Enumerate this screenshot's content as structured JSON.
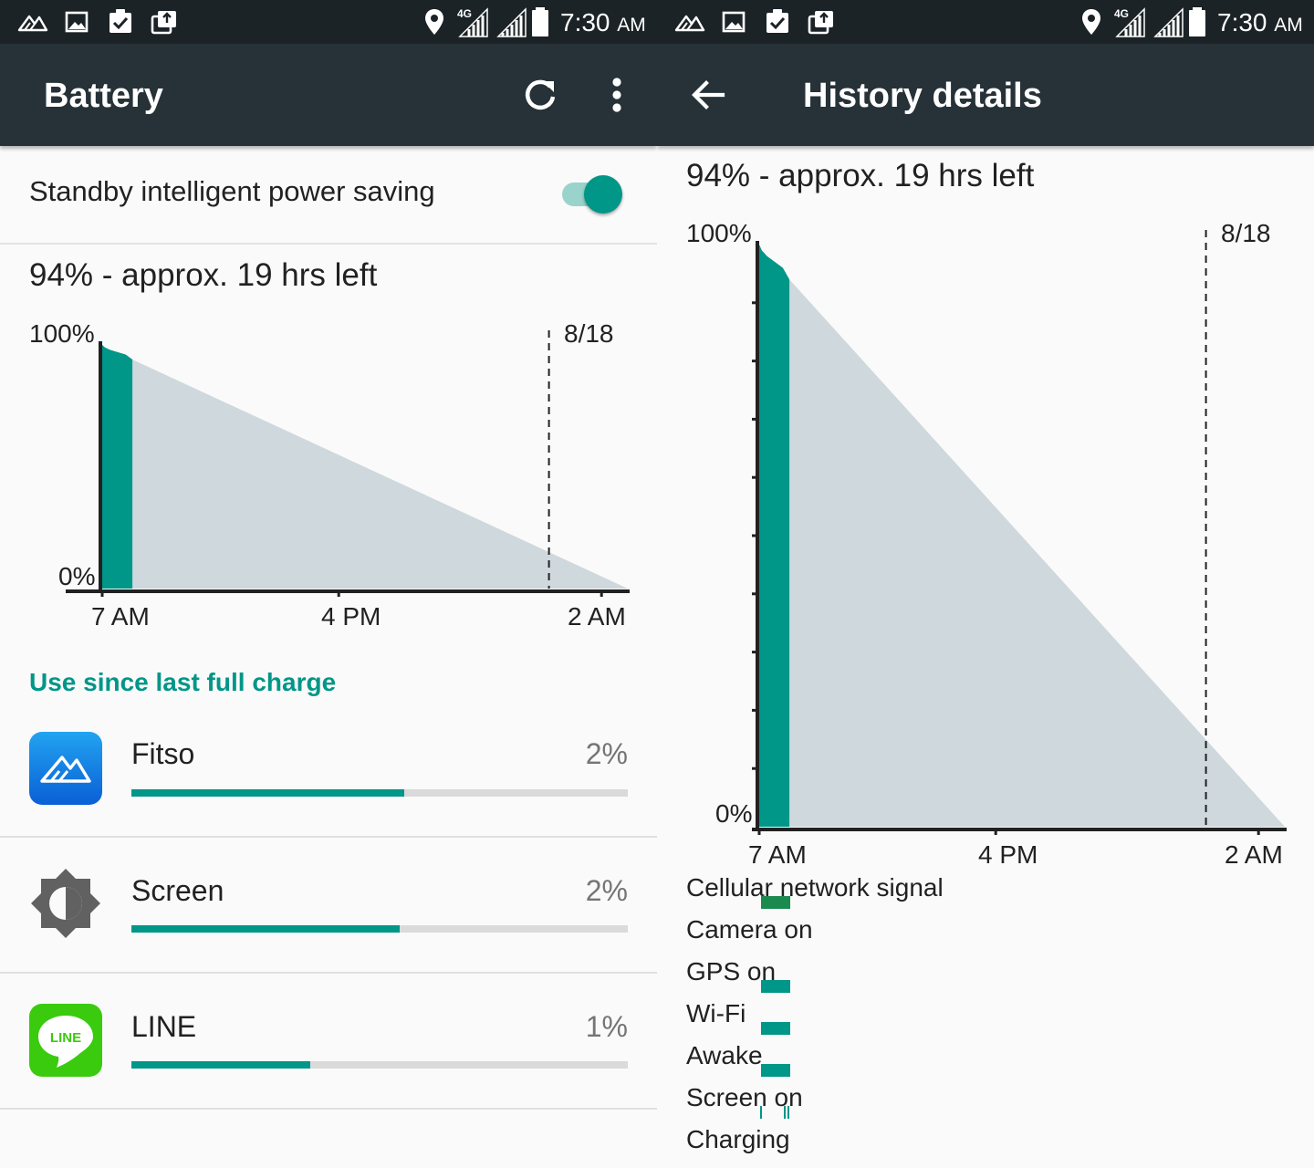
{
  "status_bar": {
    "time": "7:30",
    "ampm": "AM",
    "network": "4G",
    "icons": [
      "fitso-notification-icon",
      "image-icon",
      "task-check-icon",
      "screenshot-share-icon",
      "location-icon",
      "signal-4g-icon",
      "signal-icon",
      "battery-icon"
    ]
  },
  "left_screen": {
    "title": "Battery",
    "actions": [
      "refresh-icon",
      "more-vert-icon"
    ],
    "standby": {
      "label": "Standby intelligent power saving",
      "enabled": true
    },
    "summary": "94% - approx. 19 hrs left",
    "section_title": "Use since last full charge",
    "apps": [
      {
        "name": "Fitso",
        "percent": "2%",
        "usage_fraction": 0.55,
        "icon": "fitso-app-icon"
      },
      {
        "name": "Screen",
        "percent": "2%",
        "usage_fraction": 0.54,
        "icon": "screen-brightness-icon"
      },
      {
        "name": "LINE",
        "percent": "1%",
        "usage_fraction": 0.36,
        "icon": "line-app-icon",
        "icon_text": "LINE"
      }
    ]
  },
  "right_screen": {
    "title": "History details",
    "back_icon": "arrow-back-icon",
    "summary": "94% - approx. 19 hrs left",
    "legend": [
      "Cellular network signal",
      "Camera on",
      "GPS on",
      "Wi-Fi",
      "Awake",
      "Screen on",
      "Charging"
    ]
  },
  "colors": {
    "accent": "#009688",
    "appbar": "#263238",
    "statusbar": "#1c2326",
    "projection": "#cfd8dc",
    "signal_green": "#1b8a4e"
  },
  "chart_data": {
    "type": "area",
    "y_labels": [
      "100%",
      "0%"
    ],
    "ylim": [
      0,
      100
    ],
    "x_ticks": [
      "7 AM",
      "4 PM",
      "2 AM"
    ],
    "date_marker": "8/18",
    "series": [
      {
        "kind": "measured",
        "x_hours_after_7am": [
          0,
          0.1,
          0.3,
          0.6,
          0.9,
          1.15
        ],
        "y": [
          100,
          99,
          98,
          97,
          96,
          94
        ]
      },
      {
        "kind": "projected",
        "x_hours_after_7am": [
          1.15,
          20
        ],
        "y": [
          94,
          0
        ]
      }
    ],
    "date_marker_hours_after_7am": 17
  }
}
